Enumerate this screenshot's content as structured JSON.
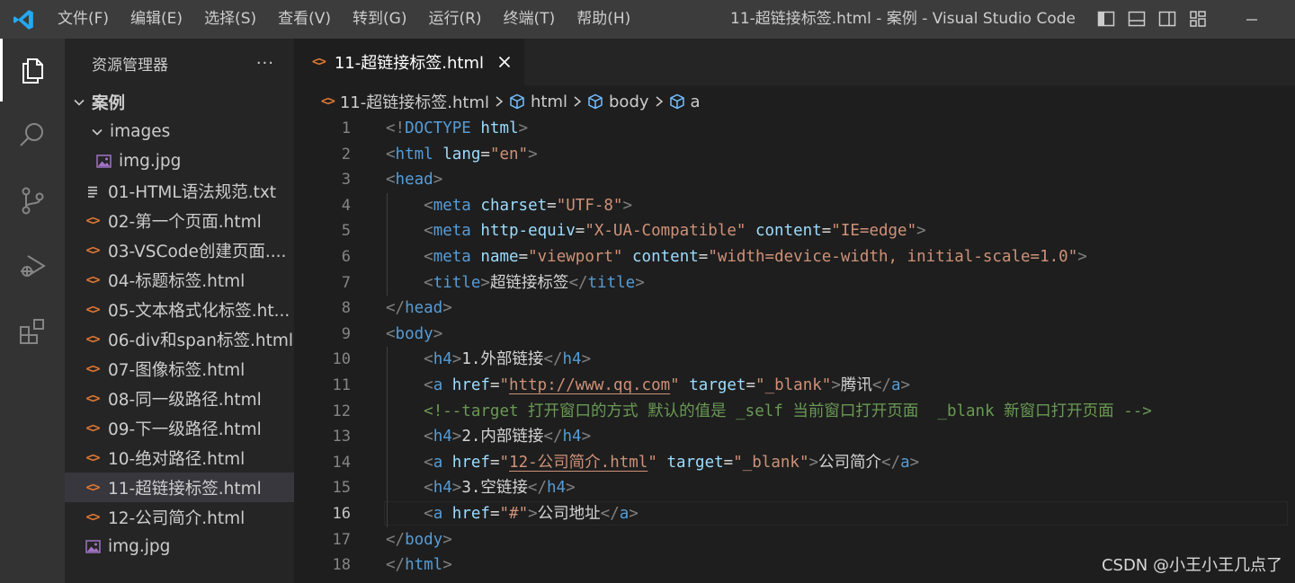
{
  "titlebar": {
    "menu": [
      "文件(F)",
      "编辑(E)",
      "选择(S)",
      "查看(V)",
      "转到(G)",
      "运行(R)",
      "终端(T)",
      "帮助(H)"
    ],
    "window_title": "11-超链接标签.html - 案例 - Visual Studio Code"
  },
  "activity": [
    "explorer-icon",
    "search-icon",
    "source-control-icon",
    "run-debug-icon",
    "extensions-icon"
  ],
  "sidebar": {
    "title": "资源管理器",
    "more": "···",
    "folder": "案例",
    "subfolder": "images",
    "items": [
      {
        "label": "img.jpg",
        "icon": "image-file-icon"
      },
      {
        "label": "01-HTML语法规范.txt",
        "icon": "text-file-icon"
      },
      {
        "label": "02-第一个页面.html",
        "icon": "html-file-icon"
      },
      {
        "label": "03-VSCode创建页面....",
        "icon": "html-file-icon"
      },
      {
        "label": "04-标题标签.html",
        "icon": "html-file-icon"
      },
      {
        "label": "05-文本格式化标签.ht...",
        "icon": "html-file-icon"
      },
      {
        "label": "06-div和span标签.html",
        "icon": "html-file-icon"
      },
      {
        "label": "07-图像标签.html",
        "icon": "html-file-icon"
      },
      {
        "label": "08-同一级路径.html",
        "icon": "html-file-icon"
      },
      {
        "label": "09-下一级路径.html",
        "icon": "html-file-icon"
      },
      {
        "label": "10-绝对路径.html",
        "icon": "html-file-icon"
      },
      {
        "label": "11-超链接标签.html",
        "icon": "html-file-icon",
        "selected": true
      },
      {
        "label": "12-公司简介.html",
        "icon": "html-file-icon"
      },
      {
        "label": "img.jpg",
        "icon": "image-file-icon"
      }
    ]
  },
  "editor": {
    "tab": {
      "label": "11-超链接标签.html",
      "close": "close-icon"
    },
    "breadcrumb": [
      "11-超链接标签.html",
      "html",
      "body",
      "a"
    ],
    "current_line": 16,
    "lines": [
      {
        "n": "1",
        "tokens": [
          [
            "t-punc",
            "<!"
          ],
          [
            "t-tag",
            "DOCTYPE"
          ],
          [
            "t-text",
            " "
          ],
          [
            "t-attr",
            "html"
          ],
          [
            "t-punc",
            ">"
          ]
        ]
      },
      {
        "n": "2",
        "tokens": [
          [
            "t-punc",
            "<"
          ],
          [
            "t-tag",
            "html"
          ],
          [
            "t-text",
            " "
          ],
          [
            "t-attr",
            "lang"
          ],
          [
            "t-text",
            "="
          ],
          [
            "t-str",
            "\"en\""
          ],
          [
            "t-punc",
            ">"
          ]
        ]
      },
      {
        "n": "3",
        "tokens": [
          [
            "t-punc",
            "<"
          ],
          [
            "t-tag",
            "head"
          ],
          [
            "t-punc",
            ">"
          ]
        ]
      },
      {
        "n": "4",
        "tokens": [
          [
            "t-text",
            "    "
          ],
          [
            "t-punc",
            "<"
          ],
          [
            "t-tag",
            "meta"
          ],
          [
            "t-text",
            " "
          ],
          [
            "t-attr",
            "charset"
          ],
          [
            "t-text",
            "="
          ],
          [
            "t-str",
            "\"UTF-8\""
          ],
          [
            "t-punc",
            ">"
          ]
        ]
      },
      {
        "n": "5",
        "tokens": [
          [
            "t-text",
            "    "
          ],
          [
            "t-punc",
            "<"
          ],
          [
            "t-tag",
            "meta"
          ],
          [
            "t-text",
            " "
          ],
          [
            "t-attr",
            "http-equiv"
          ],
          [
            "t-text",
            "="
          ],
          [
            "t-str",
            "\"X-UA-Compatible\""
          ],
          [
            "t-text",
            " "
          ],
          [
            "t-attr",
            "content"
          ],
          [
            "t-text",
            "="
          ],
          [
            "t-str",
            "\"IE=edge\""
          ],
          [
            "t-punc",
            ">"
          ]
        ]
      },
      {
        "n": "6",
        "tokens": [
          [
            "t-text",
            "    "
          ],
          [
            "t-punc",
            "<"
          ],
          [
            "t-tag",
            "meta"
          ],
          [
            "t-text",
            " "
          ],
          [
            "t-attr",
            "name"
          ],
          [
            "t-text",
            "="
          ],
          [
            "t-str",
            "\"viewport\""
          ],
          [
            "t-text",
            " "
          ],
          [
            "t-attr",
            "content"
          ],
          [
            "t-text",
            "="
          ],
          [
            "t-str",
            "\"width=device-width, initial-scale=1.0\""
          ],
          [
            "t-punc",
            ">"
          ]
        ]
      },
      {
        "n": "7",
        "tokens": [
          [
            "t-text",
            "    "
          ],
          [
            "t-punc",
            "<"
          ],
          [
            "t-tag",
            "title"
          ],
          [
            "t-punc",
            ">"
          ],
          [
            "t-text",
            "超链接标签"
          ],
          [
            "t-punc",
            "</"
          ],
          [
            "t-tag",
            "title"
          ],
          [
            "t-punc",
            ">"
          ]
        ]
      },
      {
        "n": "8",
        "tokens": [
          [
            "t-punc",
            "</"
          ],
          [
            "t-tag",
            "head"
          ],
          [
            "t-punc",
            ">"
          ]
        ]
      },
      {
        "n": "9",
        "tokens": [
          [
            "t-punc",
            "<"
          ],
          [
            "t-tag",
            "body"
          ],
          [
            "t-punc",
            ">"
          ]
        ]
      },
      {
        "n": "10",
        "tokens": [
          [
            "t-text",
            "    "
          ],
          [
            "t-punc",
            "<"
          ],
          [
            "t-tag",
            "h4"
          ],
          [
            "t-punc",
            ">"
          ],
          [
            "t-text",
            "1.外部链接"
          ],
          [
            "t-punc",
            "</"
          ],
          [
            "t-tag",
            "h4"
          ],
          [
            "t-punc",
            ">"
          ]
        ]
      },
      {
        "n": "11",
        "tokens": [
          [
            "t-text",
            "    "
          ],
          [
            "t-punc",
            "<"
          ],
          [
            "t-tag",
            "a"
          ],
          [
            "t-text",
            " "
          ],
          [
            "t-attr",
            "href"
          ],
          [
            "t-text",
            "="
          ],
          [
            "t-str",
            "\""
          ],
          [
            "t-link",
            "http://www.qq.com"
          ],
          [
            "t-str",
            "\""
          ],
          [
            "t-text",
            " "
          ],
          [
            "t-attr",
            "target"
          ],
          [
            "t-text",
            "="
          ],
          [
            "t-str",
            "\"_blank\""
          ],
          [
            "t-punc",
            ">"
          ],
          [
            "t-text",
            "腾讯"
          ],
          [
            "t-punc",
            "</"
          ],
          [
            "t-tag",
            "a"
          ],
          [
            "t-punc",
            ">"
          ]
        ]
      },
      {
        "n": "12",
        "tokens": [
          [
            "t-text",
            "    "
          ],
          [
            "t-comment",
            "<!--target 打开窗口的方式 默认的值是 _self 当前窗口打开页面  _blank 新窗口打开页面 -->"
          ]
        ]
      },
      {
        "n": "13",
        "tokens": [
          [
            "t-text",
            "    "
          ],
          [
            "t-punc",
            "<"
          ],
          [
            "t-tag",
            "h4"
          ],
          [
            "t-punc",
            ">"
          ],
          [
            "t-text",
            "2.内部链接"
          ],
          [
            "t-punc",
            "</"
          ],
          [
            "t-tag",
            "h4"
          ],
          [
            "t-punc",
            ">"
          ]
        ]
      },
      {
        "n": "14",
        "tokens": [
          [
            "t-text",
            "    "
          ],
          [
            "t-punc",
            "<"
          ],
          [
            "t-tag",
            "a"
          ],
          [
            "t-text",
            " "
          ],
          [
            "t-attr",
            "href"
          ],
          [
            "t-text",
            "="
          ],
          [
            "t-str",
            "\""
          ],
          [
            "t-link",
            "12-公司简介.html"
          ],
          [
            "t-str",
            "\""
          ],
          [
            "t-text",
            " "
          ],
          [
            "t-attr",
            "target"
          ],
          [
            "t-text",
            "="
          ],
          [
            "t-str",
            "\"_blank\""
          ],
          [
            "t-punc",
            ">"
          ],
          [
            "t-text",
            "公司简介"
          ],
          [
            "t-punc",
            "</"
          ],
          [
            "t-tag",
            "a"
          ],
          [
            "t-punc",
            ">"
          ]
        ]
      },
      {
        "n": "15",
        "tokens": [
          [
            "t-text",
            "    "
          ],
          [
            "t-punc",
            "<"
          ],
          [
            "t-tag",
            "h4"
          ],
          [
            "t-punc",
            ">"
          ],
          [
            "t-text",
            "3.空链接"
          ],
          [
            "t-punc",
            "</"
          ],
          [
            "t-tag",
            "h4"
          ],
          [
            "t-punc",
            ">"
          ]
        ]
      },
      {
        "n": "16",
        "tokens": [
          [
            "t-text",
            "    "
          ],
          [
            "t-punc",
            "<"
          ],
          [
            "t-tag",
            "a"
          ],
          [
            "t-text",
            " "
          ],
          [
            "t-attr",
            "href"
          ],
          [
            "t-text",
            "="
          ],
          [
            "t-str",
            "\"#\""
          ],
          [
            "t-punc",
            ">"
          ],
          [
            "t-text",
            "公司地址"
          ],
          [
            "t-punc",
            "</"
          ],
          [
            "t-tag",
            "a"
          ],
          [
            "t-punc",
            ">"
          ]
        ]
      },
      {
        "n": "17",
        "tokens": [
          [
            "t-punc",
            "</"
          ],
          [
            "t-tag",
            "body"
          ],
          [
            "t-punc",
            ">"
          ]
        ]
      },
      {
        "n": "18",
        "tokens": [
          [
            "t-punc",
            "</"
          ],
          [
            "t-tag",
            "html"
          ],
          [
            "t-punc",
            ">"
          ]
        ]
      }
    ]
  },
  "watermark": "CSDN @小王小王几点了",
  "colors": {
    "accent": "#007acc",
    "html_icon": "#e37933",
    "image_icon": "#a074c4"
  }
}
